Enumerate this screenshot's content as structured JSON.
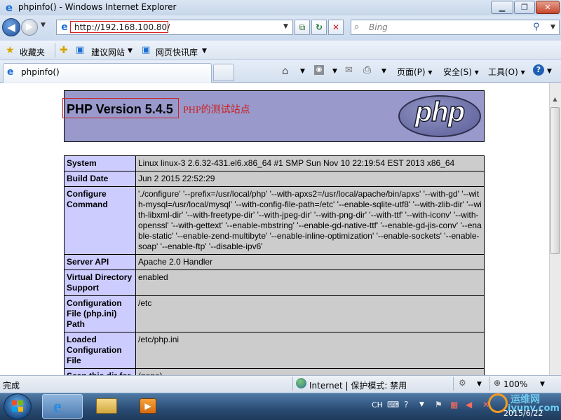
{
  "window": {
    "title": "phpinfo() - Windows Internet Explorer",
    "min": "▁",
    "max": "❐",
    "close": "✕"
  },
  "address": {
    "url": "http://192.168.100.80/",
    "search_placeholder": "Bing"
  },
  "favorites": {
    "label": "收藏夹",
    "items": [
      {
        "label": "建议网站"
      },
      {
        "label": "网页快讯库"
      }
    ]
  },
  "tab": {
    "label": "phpinfo()"
  },
  "commands": {
    "page": "页面(P)",
    "safety": "安全(S)",
    "tools": "工具(O)"
  },
  "page": {
    "php_version": "PHP Version 5.4.5",
    "annotation": "PHP的测试站点",
    "logo_text": "php",
    "rows": [
      {
        "key": "System",
        "value": "Linux linux-3 2.6.32-431.el6.x86_64 #1 SMP Sun Nov 10 22:19:54 EST 2013 x86_64"
      },
      {
        "key": "Build Date",
        "value": "Jun 2 2015 22:52:29"
      },
      {
        "key": "Configure Command",
        "value": "'./configure' '--prefix=/usr/local/php' '--with-apxs2=/usr/local/apache/bin/apxs' '--with-gd' '--with-mysql=/usr/local/mysql' '--with-config-file-path=/etc' '--enable-sqlite-utf8' '--with-zlib-dir' '--with-libxml-dir' '--with-freetype-dir' '--with-jpeg-dir' '--with-png-dir' '--with-ttf' '--with-iconv' '--with-openssl' '--with-gettext' '--enable-mbstring' '--enable-gd-native-ttf' '--enable-gd-jis-conv' '--enable-static' '--enable-zend-multibyte' '--enable-inline-optimization' '--enable-sockets' '--enable-soap' '--enable-ftp' '--disable-ipv6'"
      },
      {
        "key": "Server API",
        "value": "Apache 2.0 Handler"
      },
      {
        "key": "Virtual Directory Support",
        "value": "enabled"
      },
      {
        "key": "Configuration File (php.ini) Path",
        "value": "/etc"
      },
      {
        "key": "Loaded Configuration File",
        "value": "/etc/php.ini"
      },
      {
        "key": "Scan this dir for",
        "value": "(none)"
      }
    ]
  },
  "status": {
    "text": "完成",
    "zone": "Internet | 保护模式: 禁用",
    "zoom": "100%"
  },
  "taskbar": {
    "lang": "CH",
    "date": "2015/6/22",
    "watermark_line1": "运维网",
    "watermark_line2": "iyunv.com"
  },
  "colors": {
    "php_header_bg": "#9999cc",
    "table_key_bg": "#ccccff",
    "table_value_bg": "#cccccc",
    "annotation": "#cc2222"
  }
}
